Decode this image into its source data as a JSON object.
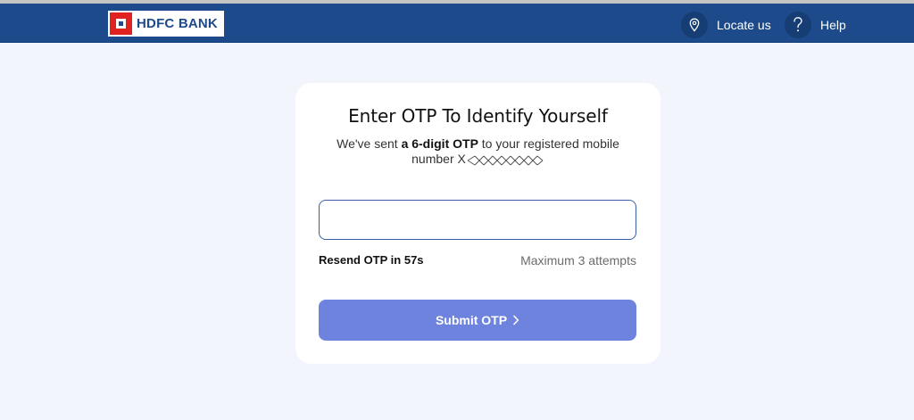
{
  "header": {
    "logo_text": "HDFC BANK",
    "nav": [
      {
        "label": "Locate us",
        "icon": "location-pin-icon"
      },
      {
        "label": "Help",
        "icon": "question-icon"
      }
    ]
  },
  "otp_card": {
    "title": "Enter OTP To Identify Yourself",
    "subtitle_prefix": "We've sent ",
    "subtitle_bold": "a 6-digit OTP",
    "subtitle_suffix": " to your registered mobile number X",
    "input_value": "",
    "input_placeholder": "",
    "resend_text": "Resend OTP in 57s",
    "attempts_text": "Maximum 3 attempts",
    "submit_label": "Submit OTP"
  },
  "colors": {
    "navbar": "#1c4a8a",
    "background": "#f3f5fd",
    "submit_button": "#6e83de",
    "brand_red": "#e02320"
  }
}
